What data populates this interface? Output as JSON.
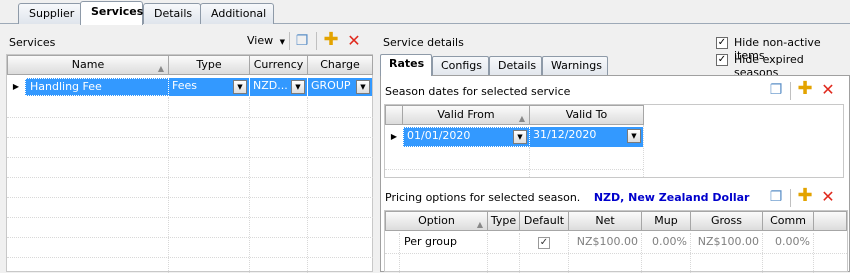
{
  "top_tabs": [
    "Supplier",
    "Services",
    "Details",
    "Additional"
  ],
  "services": {
    "title": "Services",
    "view_label": "View",
    "columns": [
      "Name",
      "Type",
      "Currency",
      "Charge"
    ],
    "rows": [
      {
        "name": "Handling Fee",
        "type": "Fees",
        "currency": "NZD...",
        "charge": "GROUP"
      }
    ]
  },
  "service_details": {
    "title": "Service details",
    "hide_nonactive_label": "Hide non-active items",
    "hide_nonactive_checked": true,
    "hide_expired_label": "Hide expired seasons",
    "hide_expired_checked": true,
    "tabs": [
      "Rates",
      "Configs",
      "Details",
      "Warnings"
    ],
    "season_title": "Season dates for selected service",
    "season_columns": [
      "Valid From",
      "Valid To"
    ],
    "season_rows": [
      {
        "valid_from": "01/01/2020",
        "valid_to": "31/12/2020"
      }
    ],
    "pricing_title": "Pricing options for selected season.",
    "pricing_currency": "NZD, New Zealand Dollar",
    "pricing_columns": [
      "Option",
      "Type",
      "Default",
      "Net",
      "Mup",
      "Gross",
      "Comm"
    ],
    "pricing_rows": [
      {
        "option": "Per group",
        "type": "",
        "default": true,
        "net": "NZ$100.00",
        "mup": "0.00%",
        "gross": "NZ$100.00",
        "comm": "0.00%"
      }
    ]
  },
  "icons": {
    "copy": "copy-icon",
    "add": "plus-icon",
    "delete": "delete-icon",
    "check": "✓",
    "row_pointer": "▶",
    "dropdown": "▼",
    "sort": "▲"
  },
  "colors": {
    "selection": "#3399ff",
    "currency_text": "#0000cc"
  }
}
